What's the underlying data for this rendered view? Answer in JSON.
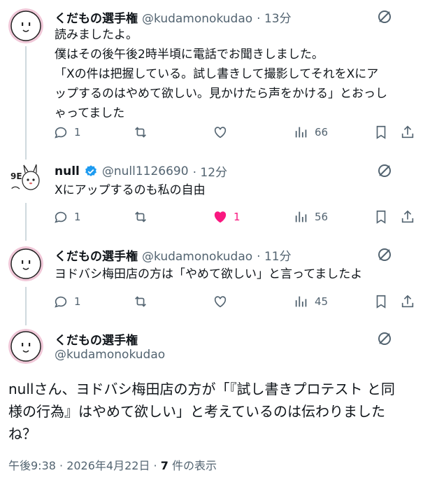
{
  "tweets": [
    {
      "name": "くだもの選手権",
      "handle": "@kudamonokudao",
      "time": "· 13分",
      "lines": [
        "読みましたよ。",
        "僕はその後午後2時半頃に電話でお聞きしました。",
        "「Xの件は把握している。試し書きして撮影してそれをXにア",
        "ップするのはやめて欲しい。見かけたら声をかける」とおっし",
        "ゃってました"
      ],
      "replies": "1",
      "reposts": "",
      "likes": "",
      "views": "66"
    },
    {
      "name": "null",
      "handle": "@null1126690",
      "time": "· 12分",
      "lines": [
        "Xにアップするのも私の自由"
      ],
      "replies": "1",
      "reposts": "",
      "likes": "1",
      "views": "56"
    },
    {
      "name": "くだもの選手権",
      "handle": "@kudamonokudao",
      "time": "· 11分",
      "lines": [
        "ヨドバシ梅田店の方は「やめて欲しい」と言ってましたよ"
      ],
      "replies": "1",
      "reposts": "",
      "likes": "",
      "views": "45"
    }
  ],
  "main": {
    "name": "くだもの選手権",
    "handle": "@kudamonokudao",
    "lines": [
      "nullさん、ヨドバシ梅田店の方が「『試し書きプロテスト と同",
      "様の行為』はやめて欲しい」と考えているのは伝わりました",
      "ね？"
    ],
    "timestamp": "午後9:38 · 2026年4月22日 · ",
    "views_count": "7",
    "views_label": " 件の表示"
  },
  "icons": [
    "reply-icon",
    "repost-icon",
    "like-icon",
    "views-icon",
    "bookmark-icon",
    "share-icon",
    "grok-slash-icon",
    "verified-badge-icon"
  ],
  "colors": {
    "text": "#0f1419",
    "secondary": "#536471",
    "liked": "#f91880",
    "verified": "#1d9bf0",
    "thread_line": "#cfd9de"
  }
}
